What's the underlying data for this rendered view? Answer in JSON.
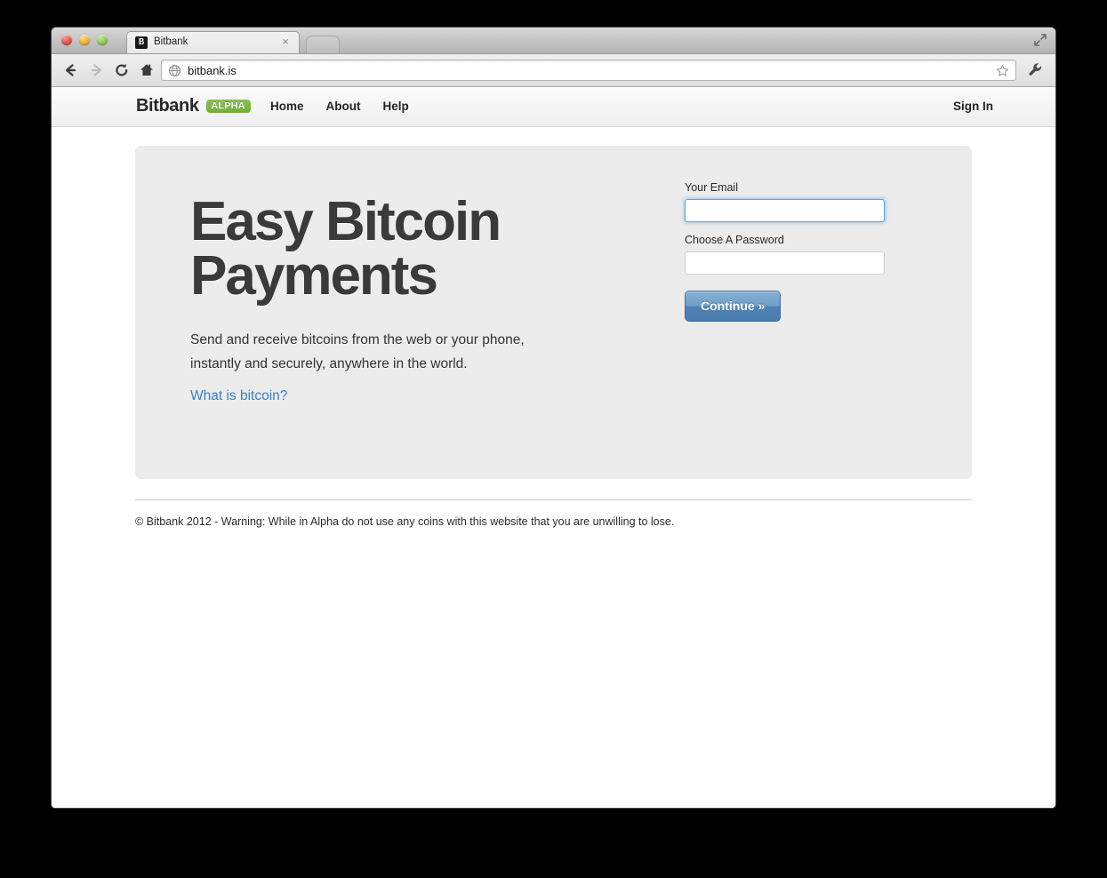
{
  "browser": {
    "tab": {
      "title": "Bitbank",
      "favicon_letter": "B",
      "close_label": "×"
    },
    "toolbar": {
      "url": "bitbank.is"
    }
  },
  "site": {
    "brand": {
      "name": "Bitbank",
      "badge": "ALPHA"
    },
    "nav": [
      {
        "label": "Home"
      },
      {
        "label": "About"
      },
      {
        "label": "Help"
      }
    ],
    "signin_label": "Sign In"
  },
  "hero": {
    "headline_line1": "Easy Bitcoin",
    "headline_line2": "Payments",
    "subcopy_line1": "Send and receive bitcoins from the web or your phone,",
    "subcopy_line2": "instantly and securely, anywhere in the world.",
    "link_label": "What is bitcoin?"
  },
  "form": {
    "email_label": "Your Email",
    "email_value": "",
    "password_label": "Choose A Password",
    "password_value": "",
    "submit_label": "Continue »"
  },
  "footer": {
    "text": "© Bitbank 2012 - Warning: While in Alpha do not use any coins with this website that you are unwilling to lose."
  },
  "colors": {
    "accent_green": "#7cb342",
    "accent_blue": "#3b7fc4",
    "button_blue": "#4f82b4",
    "focus_blue": "#5ba4e5",
    "hero_bg": "#ececec",
    "headline": "#3a3a3a"
  }
}
